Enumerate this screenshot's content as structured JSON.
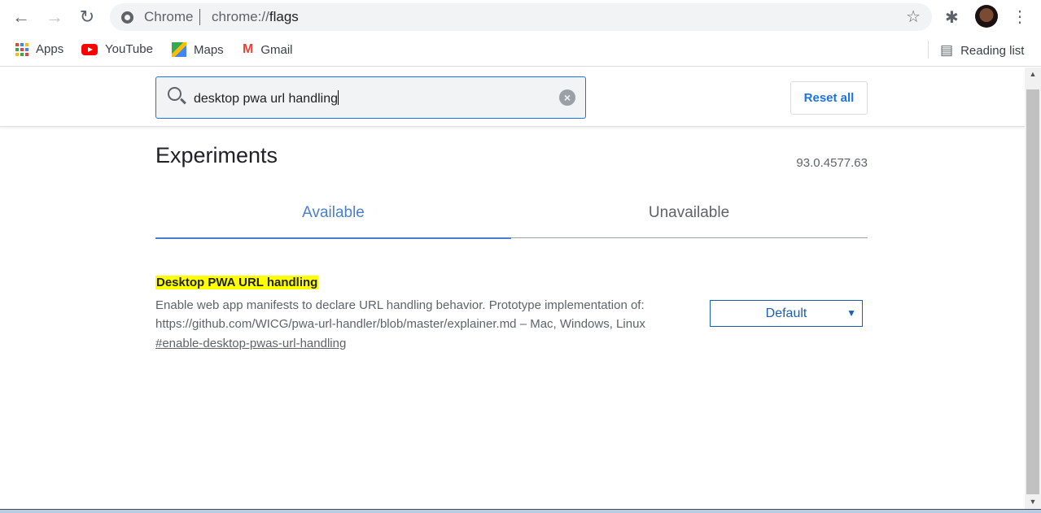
{
  "browser": {
    "omnibox": {
      "site_label": "Chrome",
      "url_prefix": "chrome://",
      "url_path": "flags"
    },
    "bookmarks": [
      {
        "label": "Apps",
        "icon": "apps-grid-icon"
      },
      {
        "label": "YouTube",
        "icon": "youtube-icon"
      },
      {
        "label": "Maps",
        "icon": "maps-icon"
      },
      {
        "label": "Gmail",
        "icon": "gmail-icon"
      }
    ],
    "reading_list": "Reading list"
  },
  "header": {
    "search_value": "desktop pwa url handling",
    "reset_label": "Reset all"
  },
  "main": {
    "title": "Experiments",
    "version": "93.0.4577.63",
    "tabs": [
      {
        "label": "Available",
        "active": true
      },
      {
        "label": "Unavailable",
        "active": false
      }
    ],
    "flag": {
      "name": "Desktop PWA URL handling",
      "description_line1": "Enable web app manifests to declare URL handling behavior. Prototype implementation of:",
      "description_line2": "https://github.com/WICG/pwa-url-handler/blob/master/explainer.md – Mac, Windows, Linux",
      "permalink": "#enable-desktop-pwas-url-handling",
      "selected": "Default"
    }
  },
  "colors": {
    "accent": "#1a73e8",
    "highlight": "#ffff00"
  }
}
